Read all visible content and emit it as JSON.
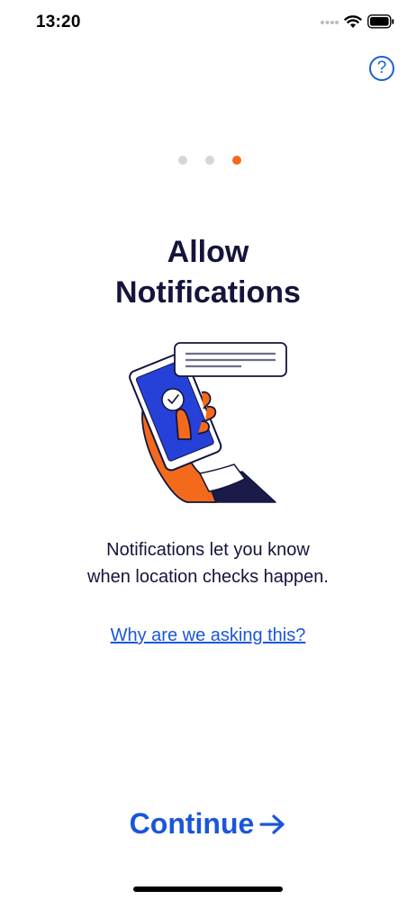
{
  "status_bar": {
    "time": "13:20",
    "icons": [
      "signal-icon",
      "wifi-icon",
      "battery-icon"
    ]
  },
  "help": {
    "label": "?"
  },
  "pager": {
    "total": 3,
    "current": 3
  },
  "title_lines": [
    "Allow",
    "Notifications"
  ],
  "illustration": "phone-notification-illustration",
  "description_lines": [
    "Notifications let you know",
    "when location checks happen."
  ],
  "why_link": "Why are we asking this?",
  "continue_button": {
    "label": "Continue",
    "icon": "arrow-right-icon"
  },
  "colors": {
    "accent_blue": "#1a56db",
    "accent_orange": "#f36a1d",
    "text_dark": "#14143c",
    "dot_inactive": "#d6d6d6"
  }
}
